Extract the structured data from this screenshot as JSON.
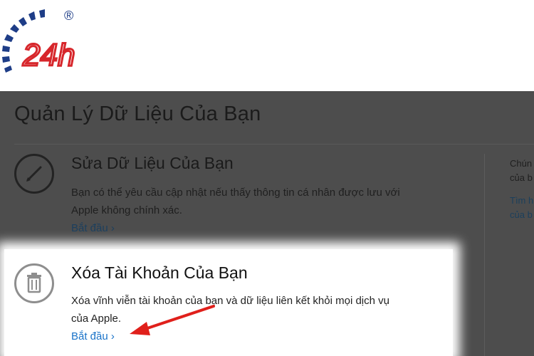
{
  "logo": {
    "text": "24h",
    "registered": "®",
    "color": "#d7262b",
    "arc_color": "#1e3d87"
  },
  "page": {
    "title": "Quản Lý Dữ Liệu Của Bạn"
  },
  "sections": [
    {
      "icon": "pencil-icon",
      "title": "Sửa Dữ Liệu Của Bạn",
      "line1": "Bạn có thể yêu cầu cập nhật nếu thấy thông tin cá nhân được lưu với",
      "line2": "Apple không chính xác.",
      "link": "Bắt đầu ›"
    },
    {
      "icon": "trash-icon",
      "title": "Xóa Tài Khoản Của Bạn",
      "line1": "Xóa vĩnh viễn tài khoản của bạn và dữ liệu liên kết khỏi mọi dịch vụ",
      "line2": "của Apple.",
      "link": "Bắt đầu ›"
    }
  ],
  "side": {
    "a1": "Chún",
    "a2": "của b",
    "b1": "Tìm h",
    "b2": "của b"
  },
  "colors": {
    "overlay": "#4d4d4d",
    "link": "#1a73c9",
    "arrow": "#e0201b"
  }
}
